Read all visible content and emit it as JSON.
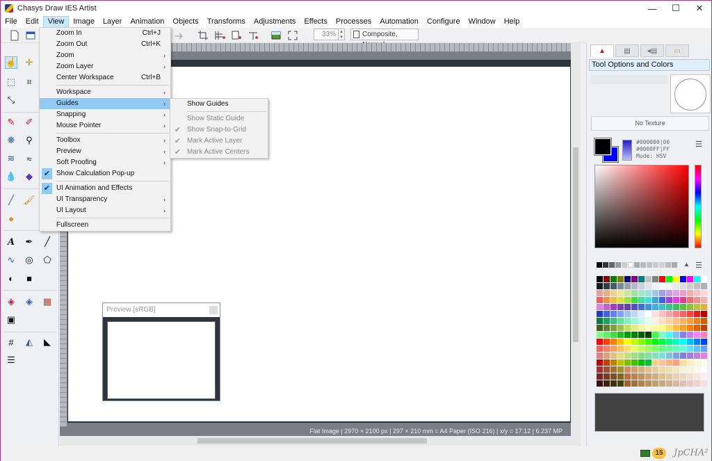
{
  "window": {
    "title": "Chasys Draw IES Artist",
    "controls": [
      "—",
      "☐",
      "✕"
    ]
  },
  "menubar": [
    "File",
    "Edit",
    "View",
    "Image",
    "Layer",
    "Animation",
    "Objects",
    "Transforms",
    "Adjustments",
    "Effects",
    "Processes",
    "Automation",
    "Configure",
    "Window",
    "Help"
  ],
  "toolbar": {
    "zoom_value": "33%",
    "composite_label": "Composite, Normal"
  },
  "view_menu": {
    "items": [
      {
        "label": "Zoom In",
        "shortcut": "Ctrl+J"
      },
      {
        "label": "Zoom Out",
        "shortcut": "Ctrl+K"
      },
      {
        "label": "Zoom",
        "submenu": true
      },
      {
        "label": "Zoom Layer",
        "submenu": true
      },
      {
        "label": "Center Workspace",
        "shortcut": "Ctrl+B"
      },
      {
        "separator": true
      },
      {
        "label": "Workspace",
        "submenu": true
      },
      {
        "label": "Guides",
        "submenu": true,
        "highlighted": true
      },
      {
        "label": "Snapping",
        "submenu": true
      },
      {
        "label": "Mouse Pointer",
        "submenu": true
      },
      {
        "separator": true
      },
      {
        "label": "Toolbox",
        "submenu": true
      },
      {
        "label": "Preview",
        "submenu": true
      },
      {
        "label": "Soft Proofing",
        "submenu": true
      },
      {
        "label": "Show Calculation Pop-up",
        "checked": true
      },
      {
        "separator": true
      },
      {
        "label": "UI Animation and Effects",
        "checked": true
      },
      {
        "label": "UI Transparency",
        "submenu": true
      },
      {
        "label": "UI Layout",
        "submenu": true
      },
      {
        "separator": true
      },
      {
        "label": "Fullscreen"
      }
    ]
  },
  "guides_menu": {
    "items": [
      {
        "label": "Show Guides"
      },
      {
        "separator": true
      },
      {
        "label": "Show Static Guide",
        "disabled": true
      },
      {
        "label": "Show Snap-to-Grid",
        "disabled": true,
        "checked": true
      },
      {
        "label": "Mark Active Layer",
        "disabled": true,
        "checked": true
      },
      {
        "label": "Mark Active Centers",
        "disabled": true,
        "checked": true
      }
    ]
  },
  "preview_window": {
    "title": "Preview [sRGB]"
  },
  "status_bar": {
    "text": "Flat Image | 2970 × 2100 px | 297 × 210 mm = A4 Paper (ISO 216) | x/y = 17:12 | 6.237 MP"
  },
  "right_panel": {
    "header": "Tool Options and Colors",
    "texture_label": "No Texture",
    "fg_code": "#000000|00",
    "bg_code": "#0000FF|FF",
    "mode_label": "Mode: HSV",
    "current_swatch_color": "#414141"
  },
  "bottom_bar": {
    "badge_count": "15",
    "brand": "JpCHA²"
  }
}
